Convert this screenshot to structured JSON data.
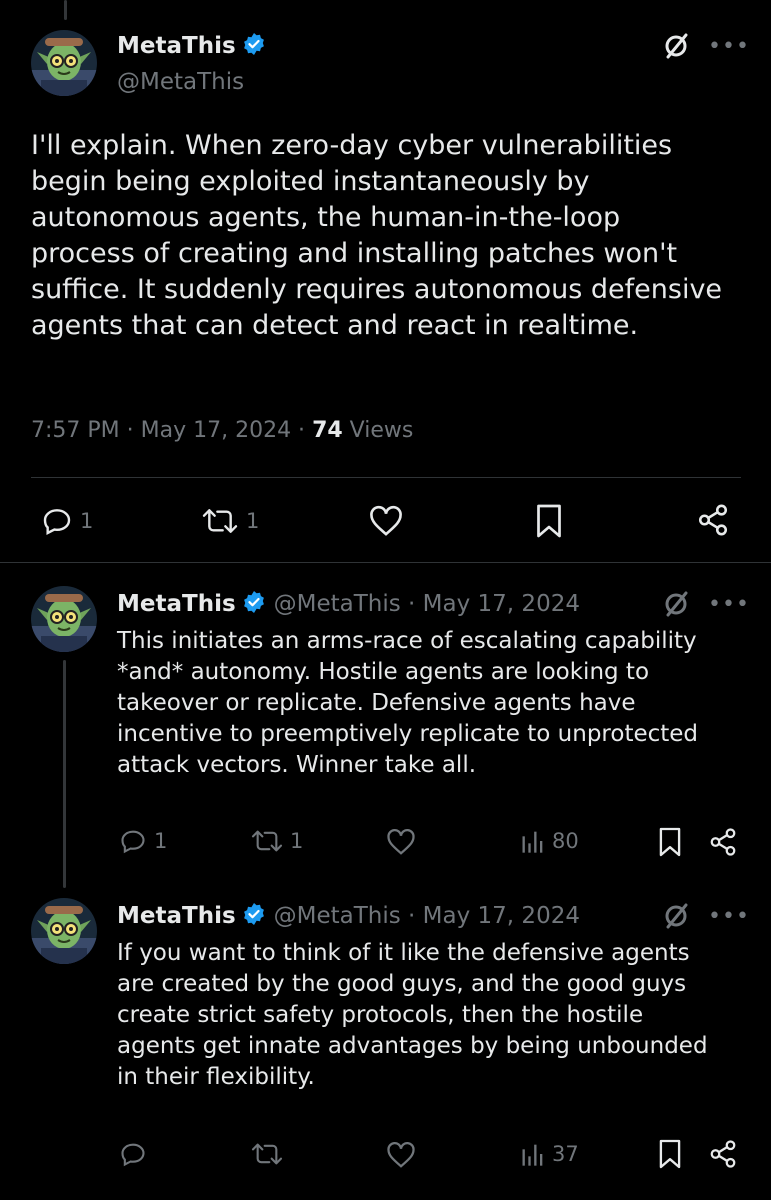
{
  "main_tweet": {
    "name": "MetaThis",
    "handle": "@MetaThis",
    "text": "I'll explain. When zero-day cyber vulnerabilities\nbegin being exploited instantaneously by\nautonomous agents, the human-in-the-loop\nprocess of creating and installing patches won't\nsuffice. It suddenly requires autonomous defensive\nagents that can detect and react in realtime.",
    "time": "7:57 PM · May 17, 2024 · ",
    "views_count": "74",
    "views_label": " Views",
    "actions": {
      "replies": "1",
      "reposts": "1"
    }
  },
  "replies": [
    {
      "name": "MetaThis",
      "handle": "@MetaThis · May 17, 2024",
      "text": "This initiates an arms-race of escalating capability\n*and* autonomy. Hostile agents are looking to\ntakeover or replicate. Defensive agents have\nincentive to preemptively replicate to unprotected\nattack vectors. Winner take all.",
      "actions": {
        "replies": "1",
        "reposts": "1",
        "views": "80"
      }
    },
    {
      "name": "MetaThis",
      "handle": "@MetaThis · May 17, 2024",
      "text": "If you want to think of it like the defensive agents\nare created by the good guys, and the good guys\ncreate strict safety protocols, then the hostile\nagents get innate advantages by being unbounded\nin their flexibility.",
      "actions": {
        "replies": "",
        "reposts": "",
        "views": "37"
      }
    }
  ],
  "more_label": "•••",
  "colors": {
    "background": "#000000",
    "text": "#e7e9ea",
    "muted": "#71767b",
    "verified": "#1d9bf0"
  }
}
